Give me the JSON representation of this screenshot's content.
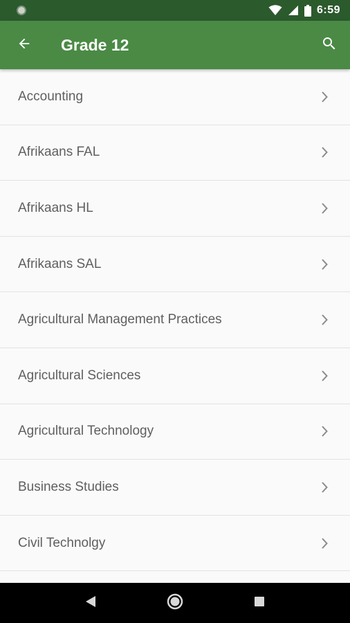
{
  "status_bar": {
    "time": "6:59",
    "icons": [
      "notification-dot-icon",
      "wifi-icon",
      "cellular-signal-icon",
      "battery-icon"
    ]
  },
  "app_bar": {
    "title": "Grade 12",
    "back_icon": "arrow-back-icon",
    "search_icon": "search-icon",
    "background_color": "#4a8a45",
    "status_bar_color": "#2b5a2d"
  },
  "subjects": [
    {
      "label": "Accounting"
    },
    {
      "label": "Afrikaans FAL"
    },
    {
      "label": "Afrikaans HL"
    },
    {
      "label": "Afrikaans SAL"
    },
    {
      "label": "Agricultural Management Practices"
    },
    {
      "label": "Agricultural Sciences"
    },
    {
      "label": "Agricultural Technology"
    },
    {
      "label": "Business Studies"
    },
    {
      "label": "Civil Technolgy"
    },
    {
      "label": ""
    }
  ],
  "nav_bar": {
    "buttons": [
      "nav-back-icon",
      "nav-home-icon",
      "nav-recents-icon"
    ]
  }
}
